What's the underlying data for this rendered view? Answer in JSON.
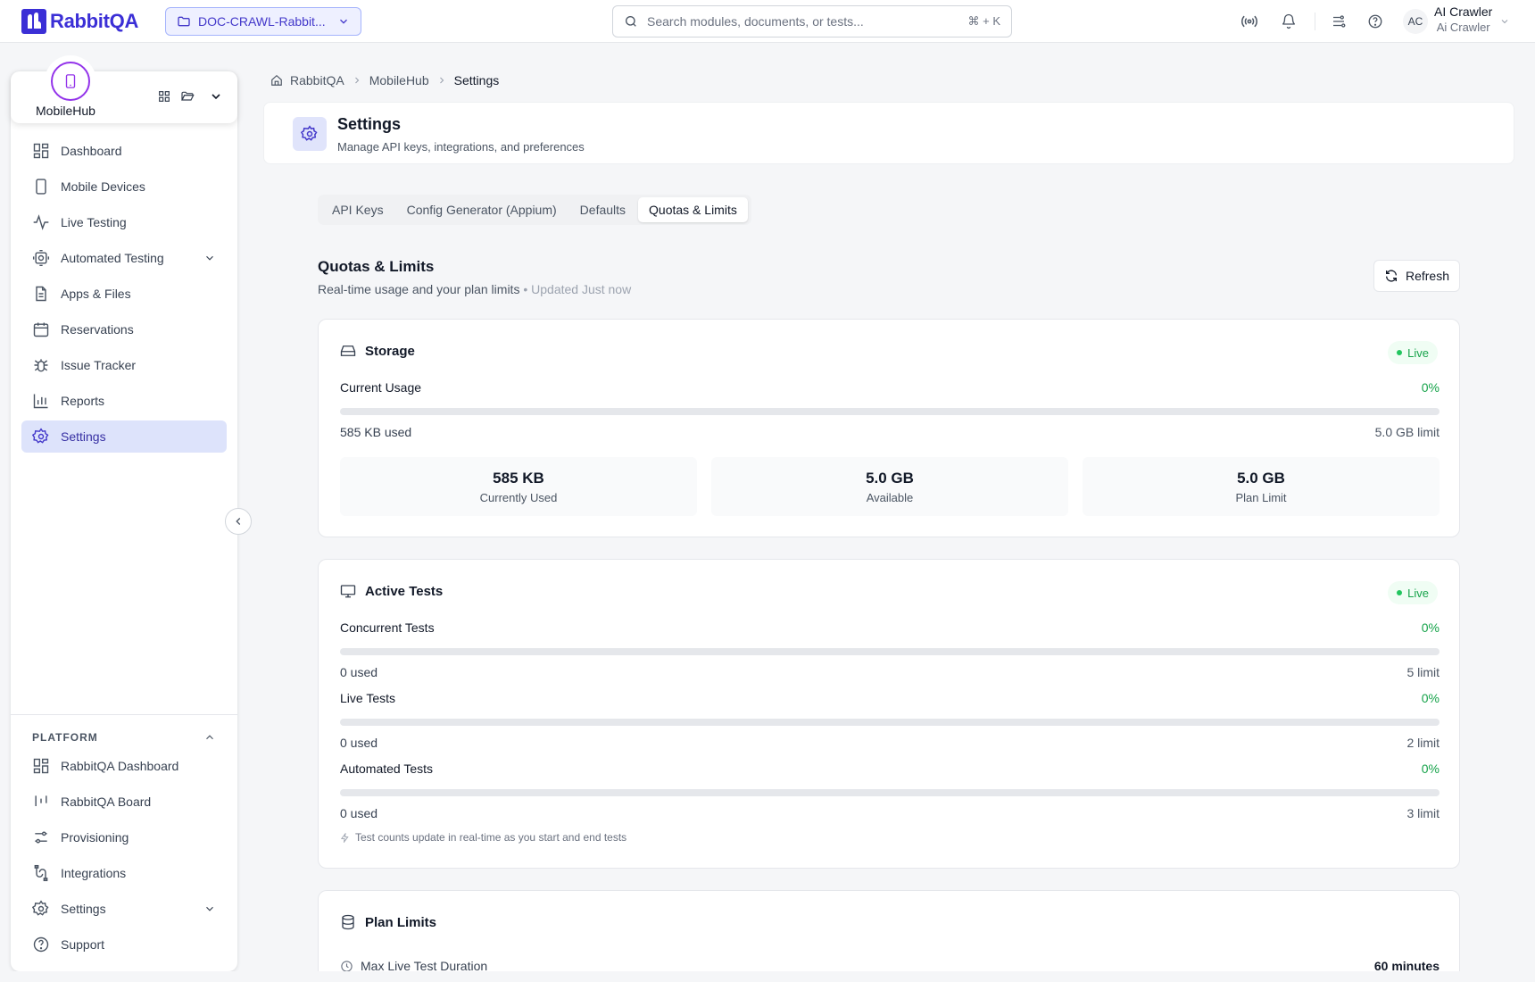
{
  "app": {
    "name": "RabbitQA",
    "brand_color": "#3b2fd6",
    "accent_color": "#4338ca",
    "success_color": "#16a34a"
  },
  "topbar": {
    "project": "DOC-CRAWL-Rabbit...",
    "search_placeholder": "Search modules, documents, or tests...",
    "search_shortcut": "⌘ + K",
    "user": {
      "initials": "AC",
      "name": "AI Crawler",
      "subtitle": "Ai Crawler"
    },
    "icons": [
      "broadcast-icon",
      "bell-icon",
      "theme-toggle-icon",
      "help-icon"
    ]
  },
  "sidebar": {
    "module_name": "MobileHub",
    "nav": [
      {
        "label": "Dashboard",
        "icon": "dashboard-icon"
      },
      {
        "label": "Mobile Devices",
        "icon": "phone-icon"
      },
      {
        "label": "Live Testing",
        "icon": "activity-icon"
      },
      {
        "label": "Automated Testing",
        "icon": "bot-icon",
        "expandable": true
      },
      {
        "label": "Apps & Files",
        "icon": "file-icon"
      },
      {
        "label": "Reservations",
        "icon": "calendar-icon"
      },
      {
        "label": "Issue Tracker",
        "icon": "bug-icon"
      },
      {
        "label": "Reports",
        "icon": "bar-chart-icon"
      },
      {
        "label": "Settings",
        "icon": "gear-icon",
        "active": true
      }
    ],
    "platform_label": "PLATFORM",
    "platform": [
      {
        "label": "RabbitQA Dashboard",
        "icon": "dashboard-icon"
      },
      {
        "label": "RabbitQA Board",
        "icon": "kanban-icon"
      },
      {
        "label": "Provisioning",
        "icon": "sliders-icon"
      },
      {
        "label": "Integrations",
        "icon": "integrations-icon"
      },
      {
        "label": "Settings",
        "icon": "gear-icon",
        "expandable": true
      },
      {
        "label": "Support",
        "icon": "help-icon"
      }
    ]
  },
  "breadcrumb": [
    "RabbitQA",
    "MobileHub",
    "Settings"
  ],
  "header": {
    "title": "Settings",
    "subtitle": "Manage API keys, integrations, and preferences"
  },
  "tabs": [
    {
      "label": "API Keys"
    },
    {
      "label": "Config Generator (Appium)"
    },
    {
      "label": "Defaults"
    },
    {
      "label": "Quotas & Limits",
      "active": true
    }
  ],
  "quotas": {
    "title": "Quotas & Limits",
    "subtitle": "Real-time usage and your plan limits",
    "updated": "• Updated Just now",
    "refresh_label": "Refresh",
    "storage": {
      "title": "Storage",
      "badge": "Live",
      "meter": {
        "label": "Current Usage",
        "percent": "0%",
        "fraction": 0,
        "used": "585 KB used",
        "limit": "5.0 GB limit"
      },
      "stats": [
        {
          "value": "585 KB",
          "label": "Currently Used"
        },
        {
          "value": "5.0 GB",
          "label": "Available"
        },
        {
          "value": "5.0 GB",
          "label": "Plan Limit"
        }
      ]
    },
    "active_tests": {
      "title": "Active Tests",
      "badge": "Live",
      "meters": [
        {
          "label": "Concurrent Tests",
          "percent": "0%",
          "fraction": 0,
          "used": "0 used",
          "limit": "5 limit"
        },
        {
          "label": "Live Tests",
          "percent": "0%",
          "fraction": 0,
          "used": "0 used",
          "limit": "2 limit"
        },
        {
          "label": "Automated Tests",
          "percent": "0%",
          "fraction": 0,
          "used": "0 used",
          "limit": "3 limit"
        }
      ],
      "note": "Test counts update in real-time as you start and end tests"
    },
    "plan_limits": {
      "title": "Plan Limits",
      "rows": [
        {
          "label": "Max Live Test Duration",
          "value": "60 minutes"
        }
      ]
    }
  }
}
